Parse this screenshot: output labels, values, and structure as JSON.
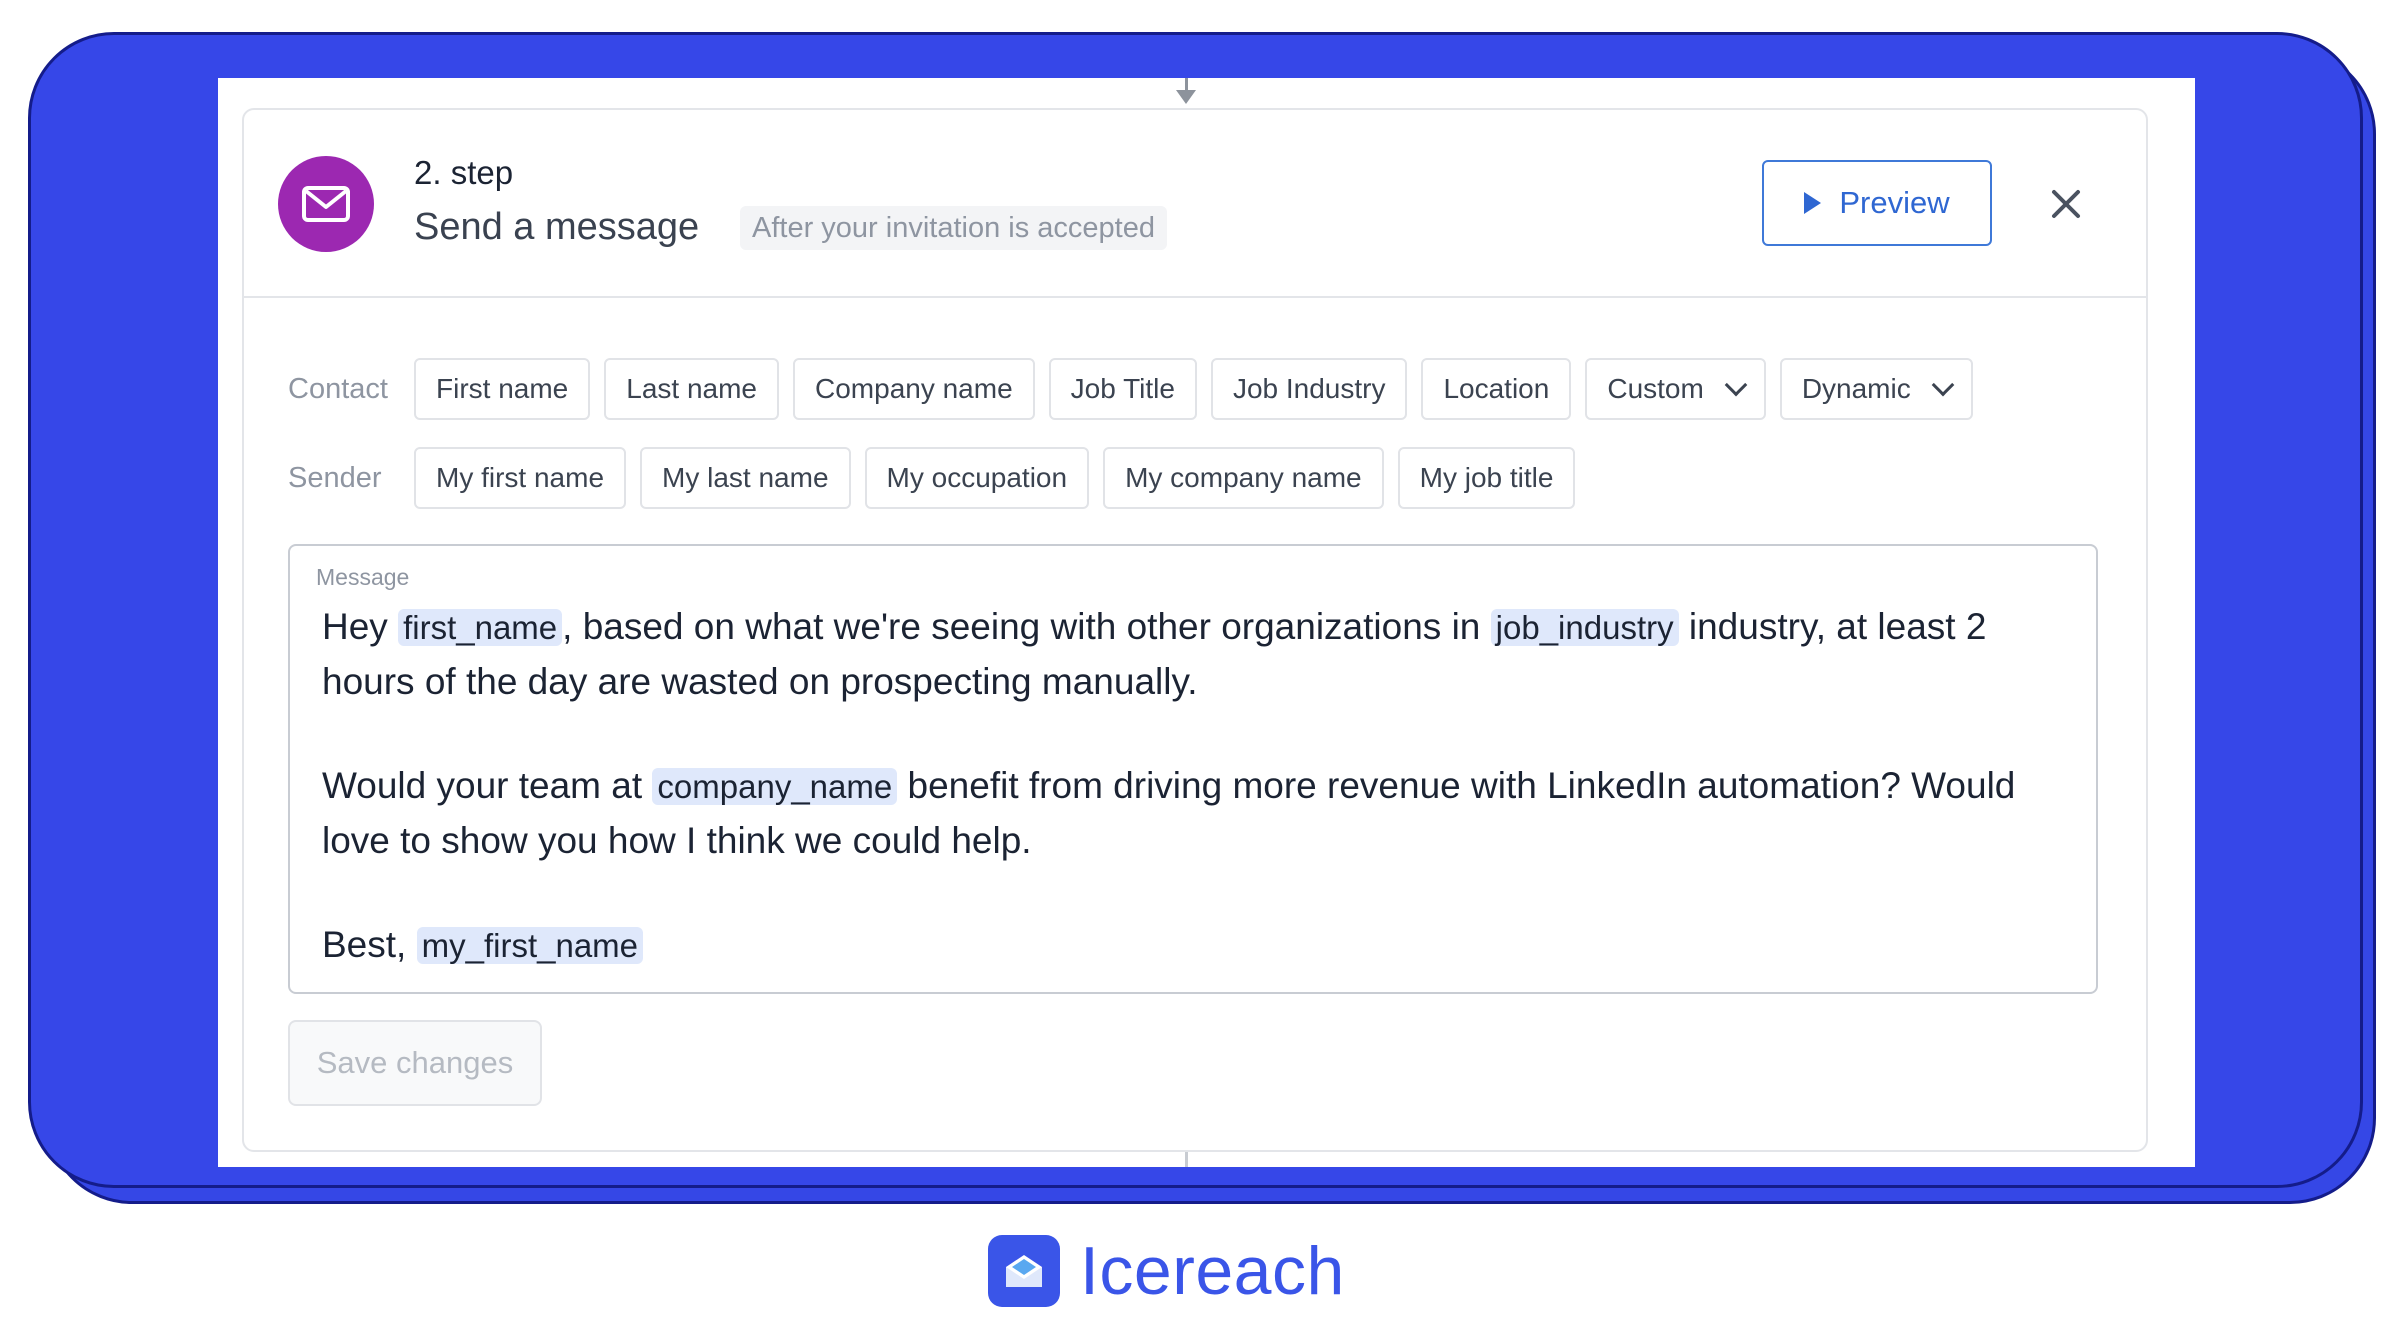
{
  "step": {
    "number_label": "2. step",
    "title": "Send a message",
    "condition_tag": "After your invitation is accepted",
    "preview_label": "Preview"
  },
  "contact_row": {
    "label": "Contact",
    "chips": [
      "First name",
      "Last name",
      "Company name",
      "Job Title",
      "Job Industry",
      "Location"
    ],
    "dropdowns": [
      "Custom",
      "Dynamic"
    ]
  },
  "sender_row": {
    "label": "Sender",
    "chips": [
      "My first name",
      "My last name",
      "My occupation",
      "My company name",
      "My job title"
    ]
  },
  "message": {
    "label": "Message",
    "p1_a": "Hey ",
    "p1_var1": "first_name",
    "p1_b": ", based on what we're seeing with other organizations in ",
    "p1_var2": "job_industry",
    "p1_c": " industry, at least 2 hours of the day are wasted on prospecting manually.",
    "p2_a": "Would your team at ",
    "p2_var1": "company_name",
    "p2_b": " benefit from driving more revenue with LinkedIn automation? Would love to show you how I think we could help.",
    "p3_a": "Best, ",
    "p3_var1": "my_first_name"
  },
  "save_label": "Save changes",
  "brand": {
    "name": "Icereach"
  },
  "icons": [
    "mail-icon",
    "play-icon",
    "close-icon",
    "chevron-down-icon",
    "icereach-logo-icon"
  ],
  "colors": {
    "frame": "#3647e8",
    "step_icon": "#9c28b1",
    "accent": "#2f67d2",
    "brand": "#3a55e8",
    "variable_highlight": "#dfe8fb"
  }
}
